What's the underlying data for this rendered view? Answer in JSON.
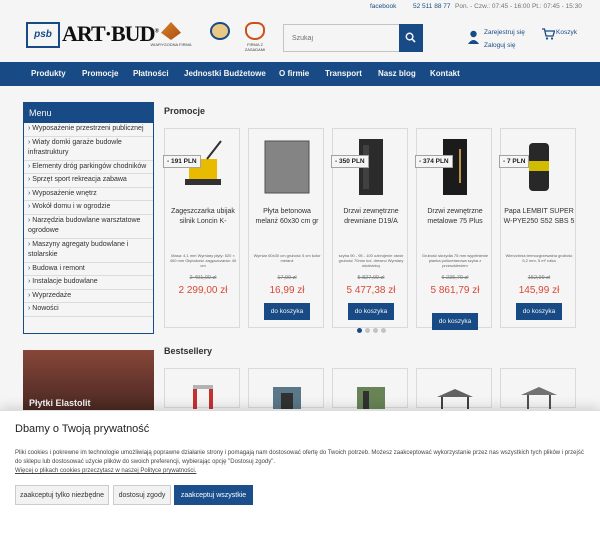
{
  "topbar": {
    "facebook": "facebook",
    "phone": "52 511 88 77",
    "hours": "Pon. - Czw.: 07:45 - 16:00 Pt.: 07:45 - 15:30"
  },
  "header": {
    "logo_psb": "psb",
    "logo_main": "ART·BUD",
    "cert1": "WIARYGODNA FIRMA",
    "cert3": "FIRMA Z ZASADAMI",
    "search_placeholder": "Szukaj",
    "register": "Zarejestruj się",
    "login": "Zaloguj się",
    "cart": "Koszyk"
  },
  "nav": {
    "items": [
      "Produkty",
      "Promocje",
      "Płatności",
      "Jednostki Budżetowe",
      "O firmie",
      "Transport",
      "Nasz blog",
      "Kontakt"
    ]
  },
  "sidebar": {
    "title": "Menu",
    "items": [
      "Wyposażenie przestrzeni publicznej",
      "Wiaty domki garaże budowle infrastruktury",
      "Elementy dróg parkingów chodników",
      "Sprzęt sport rekreacja zabawa",
      "Wyposażenie wnętrz",
      "Wokół domu i w ogrodzie",
      "Narzędzia budowlane warsztatowe ogrodowe",
      "Maszyny agregaty budowlane i stolarskie",
      "Budowa i remont",
      "Instalacje budowlane",
      "Wyprzedaże",
      "Nowości"
    ],
    "banner_text": "Płytki Elastolit"
  },
  "promo": {
    "title": "Promocje",
    "button_label": "do koszyka",
    "products": [
      {
        "badge": "- 191 PLN",
        "name": "Zagęszczarka ubijak silnik Loncin K-",
        "spec": "Masa: 4,1 mm Wymiary płyty: 520 × 400 mm Głębokość zagęszczania: 40 cm",
        "old": "2 491,00 zł",
        "new": "2 299,00 zł"
      },
      {
        "badge": "",
        "name": "Płyta betonowa melanż 60x30 cm gr",
        "spec": "Wymiar 60x30 cm grubość 5 cm kolor melanż",
        "old": "17,99 zł",
        "new": "16,99 zł"
      },
      {
        "badge": "- 350 PLN",
        "name": "Drzwi zewnętrzne drewniane D19/A",
        "spec": "szyba 90 - 95 - 100 uzbrojenie otwór grubość 70mm kol. drewno Wymiary ościeżnicy",
        "old": "5 827,00 zł",
        "new": "5 477,38 zł"
      },
      {
        "badge": "- 374 PLN",
        "name": "Drzwi zewnętrzne metalowe 75 Plus",
        "spec": "Grubość skrzydła 75 mm wypełnienie pianka poliuretanowa szyba z przeszkleniem",
        "old": "6 235,79 zł",
        "new": "5 861,79 zł"
      },
      {
        "badge": "- 7 PLN",
        "name": "Papa LEMBIT SUPER W-PYE250 S52 SBS 5",
        "spec": "Wierzchnia termozgrzewalna grubość 5,2 mm, 5 m² rolka",
        "old": "152,99 zł",
        "new": "145,99 zł"
      }
    ]
  },
  "bestsellers": {
    "title": "Bestsellery"
  },
  "cookie": {
    "title": "Dbamy o Twoją prywatność",
    "text": "Pliki cookies i pokrewne im technologie umożliwiają poprawne działanie strony i pomagają nam dostosować ofertę do Twoich potrzeb. Możesz zaakceptować wykorzystanie przez nas wszystkich tych plików i przejść do sklepu lub dostosować użycie plików do swoich preferencji, wybierając opcję \"Dostosuj zgody\".",
    "policy_link": "Więcej o plikach cookies przeczytasz w naszej Polityce prywatności.",
    "btn_necessary": "zaakceptuj tylko niezbędne",
    "btn_customize": "dostosuj zgody",
    "btn_accept_all": "zaakceptuj wszystkie"
  },
  "colors": {
    "brand": "#1a4f8b",
    "price": "#e24c3b"
  }
}
